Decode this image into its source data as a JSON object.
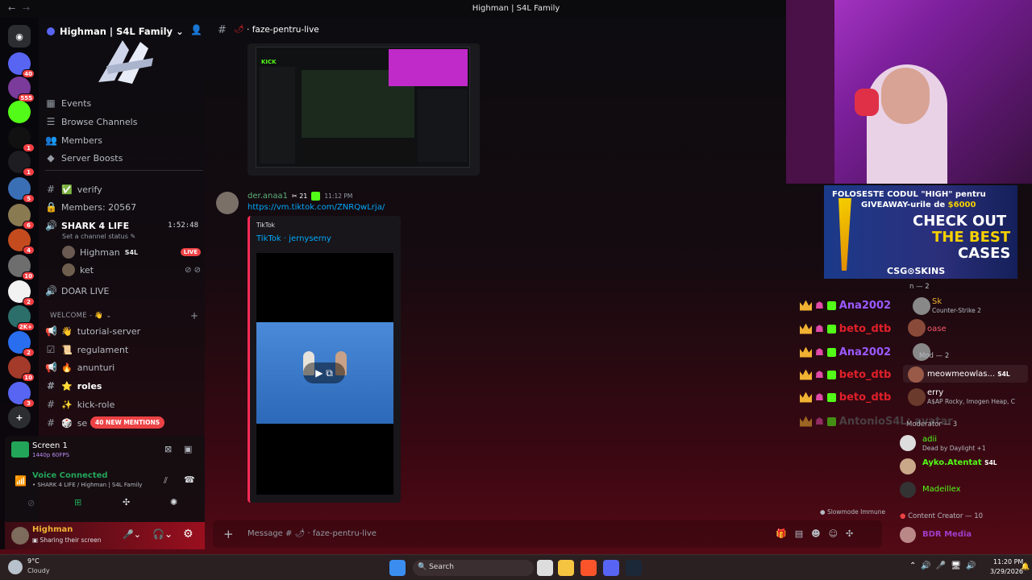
{
  "window": {
    "title": "Highman | S4L Family"
  },
  "rail_servers": [
    {
      "badge": "",
      "color": "#2b2d31"
    },
    {
      "badge": "40",
      "color": "#5865f2"
    },
    {
      "badge": "555",
      "color": "#7a3b9a"
    },
    {
      "badge": "",
      "color": "#53fc18"
    },
    {
      "badge": "1",
      "color": "#111111"
    },
    {
      "badge": "1",
      "color": "#1d1d22"
    },
    {
      "badge": "5",
      "color": "#3a6fb5"
    },
    {
      "badge": "6",
      "color": "#8a7a52"
    },
    {
      "badge": "4",
      "color": "#c44b1e"
    },
    {
      "badge": "10",
      "color": "#6e6e6e"
    },
    {
      "badge": "2",
      "color": "#f2f2f2"
    },
    {
      "badge": "2K+",
      "color": "#2b6e6a"
    },
    {
      "badge": "2",
      "color": "#2a6ef0"
    },
    {
      "badge": "10",
      "color": "#a33a2a"
    },
    {
      "badge": "3",
      "color": "#5865f2"
    },
    {
      "badge": "",
      "color": "#2b2d31"
    }
  ],
  "sidebar": {
    "server_name": "Highman | S4L Family",
    "menu": [
      "Events",
      "Browse Channels",
      "Members",
      "Server Boosts"
    ],
    "channels": [
      {
        "icon": "#",
        "prefix": "✅",
        "name": "verify"
      },
      {
        "icon": "👤",
        "prefix": "",
        "name": "Members: 20567"
      }
    ],
    "voice": {
      "name": "SHARK 4 LIFE",
      "time": "1:52:48",
      "status": "Set a channel status",
      "users": [
        {
          "name": "Highman",
          "tag": "S4L",
          "live": "LIVE"
        },
        {
          "name": "ket"
        }
      ]
    },
    "voice2": "DOAR LIVE",
    "category": "WELCOME -",
    "welcome": [
      "tutorial-server",
      "regulament",
      "anunturi",
      "roles",
      "kick-role",
      "se"
    ],
    "mentions": "40 NEW MENTIONS"
  },
  "panel": {
    "screen_title": "Screen 1",
    "screen_sub": "1440p 60FPS",
    "voice_title": "Voice Connected",
    "voice_sub": "SHARK 4 LIFE / Highman | S4L Family",
    "user_name": "Highman",
    "user_status": "Sharing their screen"
  },
  "channel": {
    "name": "faze-pentru-live"
  },
  "message": {
    "author": "der.anaa1",
    "badge_num": "21",
    "time": "11:12 PM",
    "link": "https://vm.tiktok.com/ZNRQwLrja/",
    "embed_provider": "TikTok",
    "embed_title": "TikTok · jernyserny"
  },
  "input": {
    "placeholder_prefix": "Message #",
    "channel": "faze-pentru-live",
    "slowmode": "Slowmode Immune"
  },
  "ad": {
    "line1": "FOLOSESTE CODUL \"HIGH\" pentru",
    "line2": "GIVEAWAY-urile de",
    "amount": "$6000",
    "headline1": "CHECK OUT",
    "headline2": "THE BEST",
    "headline3": "CASES",
    "brand": "CSG⊙SKINS"
  },
  "stream_chat": [
    {
      "name": "Ana2002",
      "color": "#9b59ff"
    },
    {
      "name": "beto_dtb",
      "color": "#e0202a"
    },
    {
      "name": "Ana2002",
      "color": "#9b59ff"
    },
    {
      "name": "beto_dtb",
      "color": "#e0202a"
    },
    {
      "name": "beto_dtb",
      "color": "#e0202a"
    },
    {
      "name": "AntonioS4L: avatar",
      "color": "#5a6a6a"
    }
  ],
  "members_overlay": {
    "group1": "n — 2",
    "u1": "Sk",
    "u1_act": "Counter-Strike 2",
    "u2": "oase",
    "group2": "Mod — 2",
    "u3": "meowmeowlas...",
    "u3_tag": "S4L",
    "u4": "erry",
    "u4_act": "A$AP Rocky, Imogen Heap, C",
    "group3": "Moderator — 3",
    "m1": "adii",
    "m1_act": "Dead by Daylight +1",
    "m2": "Ayko.Atentat",
    "m2_tag": "S4L",
    "m3": "Madeillex",
    "group4": "Content Creator — 10",
    "m4": "BDR Media"
  },
  "taskbar": {
    "temp": "9°C",
    "weather": "Cloudy",
    "search": "Search",
    "time": "11:20 PM",
    "date": "3/29/2026"
  },
  "colors": {
    "live": "#ed4245",
    "link": "#00a8fc",
    "accent": "#5865f2",
    "kick": "#53fc18"
  }
}
